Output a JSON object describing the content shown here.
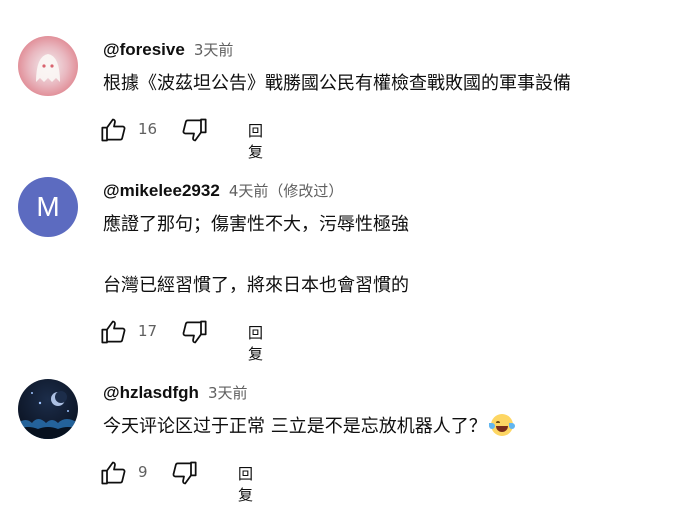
{
  "comments": [
    {
      "author": "@foresive",
      "meta": "3天前",
      "lines": [
        "根據《波茲坦公告》戰勝國公民有權檢查戰敗國的軍事設備"
      ],
      "likes": "16",
      "reply": "回复"
    },
    {
      "author": "@mikelee2932",
      "meta": "4天前（修改过）",
      "avatar_letter": "M",
      "lines": [
        "應證了那句；傷害性不大，污辱性極強",
        "台灣已經習慣了，將來日本也會習慣的"
      ],
      "likes": "17",
      "reply": "回复"
    },
    {
      "author": "@hzlasdfgh",
      "meta": "3天前",
      "lines": [
        "今天评论区过于正常 三立是不是忘放机器人了？"
      ],
      "likes": "9",
      "reply": "回复"
    }
  ],
  "icons": {
    "like": "thumbs-up-icon",
    "dislike": "thumbs-down-icon",
    "emoji": "laughing-tears-emoji-icon"
  },
  "colors": {
    "avatar_m": "#5c6bc0",
    "meta_gray": "#606060"
  }
}
